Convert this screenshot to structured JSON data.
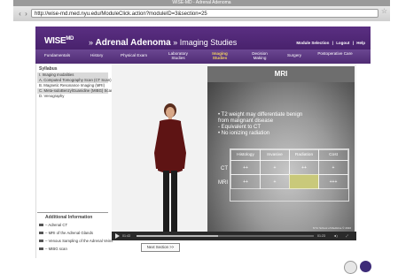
{
  "browser": {
    "title": "WISE-MD - Adrenal Adenoma",
    "url": "http://wise-md.med.nyu.edu/ModuleClick.action?moduleID=3&section=25"
  },
  "header": {
    "logo": "WISE",
    "logo_suffix": "MD",
    "title_prefix": "» ",
    "title_bold": "Adrenal Adenoma",
    "title_rest": " » Imaging Studies",
    "links": [
      "Module Selection",
      "|",
      "Logout",
      "|",
      "Help"
    ]
  },
  "nav": {
    "items": [
      {
        "label": "Fundamentals",
        "active": false
      },
      {
        "label": "History",
        "active": false
      },
      {
        "label": "Physical Exam",
        "active": false
      },
      {
        "label": "Laboratory Studies",
        "active": false
      },
      {
        "label": "Imaging Studies",
        "active": true
      },
      {
        "label": "Decision Making",
        "active": false
      },
      {
        "label": "Surgery",
        "active": false
      },
      {
        "label": "Postoperative Care",
        "active": false
      }
    ]
  },
  "syllabus": {
    "title": "Syllabus",
    "items": [
      {
        "label": "I. Imaging modalities",
        "highlight": true
      },
      {
        "label": "A. Computed Tomography Scan (CT Scan)",
        "highlight": true
      },
      {
        "label": "B. Magnetic Resonance Imaging (MRI)",
        "highlight": false
      },
      {
        "label": "C. Meta-IodoBenzylGuanidine (MIBG) Scan",
        "highlight": true
      },
      {
        "label": "D. Venography",
        "highlight": false
      }
    ]
  },
  "additional_info": {
    "title": "Additional Information",
    "links": [
      "– Adrenal CT",
      "– MRI of the Adrenal Glands",
      "– Venous Sampling of the Adrenal Veins",
      "– MIBG scan"
    ]
  },
  "slide": {
    "title": "MRI",
    "bullets": [
      "• T2 weight may differentiate benign",
      "   from malignant disease",
      "   - Equivalent to CT",
      "• No ionizing radiation"
    ],
    "columns": [
      "Histology",
      "Invasive",
      "Radiation",
      "Cost"
    ],
    "rows": [
      {
        "label": "CT",
        "cells": [
          "++",
          "+",
          "++",
          "+"
        ]
      },
      {
        "label": "MRI",
        "cells": [
          "++",
          "+",
          "",
          "+++"
        ]
      }
    ],
    "copyright": "NYU School of Medicine © 2010"
  },
  "player": {
    "time_elapsed": "01:43",
    "time_total": "01:23",
    "progress": 0.46
  },
  "next_button": "Next Section >>",
  "colors": {
    "header_purple": "#4a2570",
    "nav_active": "#f0d060",
    "mri_highlight": "#c9c97a"
  }
}
